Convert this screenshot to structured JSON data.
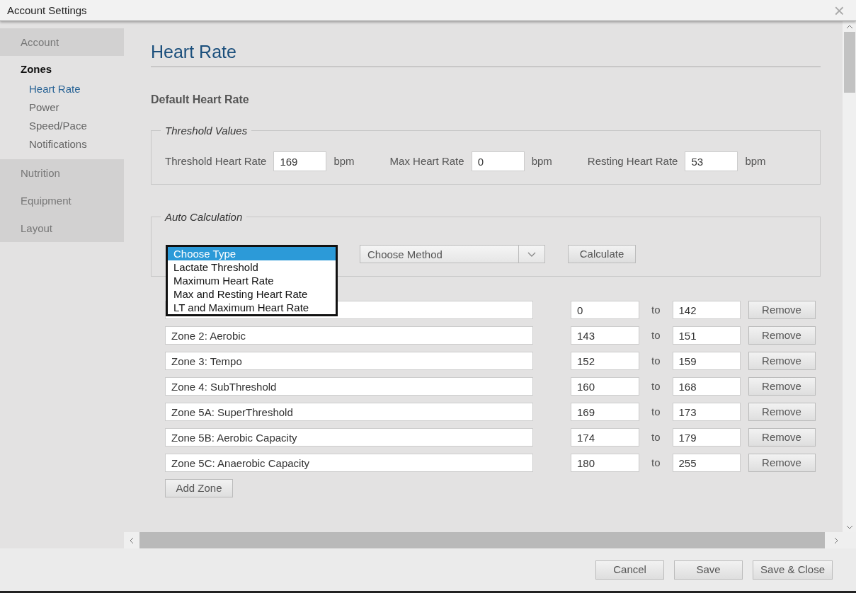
{
  "window": {
    "title": "Account Settings",
    "close": "×"
  },
  "sidebar": {
    "items": [
      {
        "label": "Account",
        "selected": false
      },
      {
        "label": "Zones",
        "selected": true,
        "children": [
          {
            "label": "Heart Rate",
            "selected": true
          },
          {
            "label": "Power",
            "selected": false
          },
          {
            "label": "Speed/Pace",
            "selected": false
          },
          {
            "label": "Notifications",
            "selected": false
          }
        ]
      },
      {
        "label": "Nutrition",
        "selected": false
      },
      {
        "label": "Equipment",
        "selected": false
      },
      {
        "label": "Layout",
        "selected": false
      }
    ]
  },
  "page": {
    "title": "Heart Rate",
    "section": "Default Heart Rate"
  },
  "threshold_values": {
    "legend": "Threshold Values",
    "fields": [
      {
        "label": "Threshold Heart Rate",
        "value": "169",
        "unit": "bpm"
      },
      {
        "label": "Max Heart Rate",
        "value": "0",
        "unit": "bpm"
      },
      {
        "label": "Resting Heart Rate",
        "value": "53",
        "unit": "bpm"
      }
    ]
  },
  "auto_calculation": {
    "legend": "Auto Calculation",
    "type_options": [
      {
        "label": "Choose Type",
        "selected": true
      },
      {
        "label": "Lactate Threshold",
        "selected": false
      },
      {
        "label": "Maximum Heart Rate",
        "selected": false
      },
      {
        "label": "Max and Resting Heart Rate",
        "selected": false
      },
      {
        "label": "LT and Maximum Heart Rate",
        "selected": false
      }
    ],
    "method": "Choose Method",
    "calculate": "Calculate"
  },
  "zones": [
    {
      "from": "0",
      "to_label": "to",
      "to": "142",
      "remove": "Remove"
    },
    {
      "name": "Zone 2: Aerobic",
      "from": "143",
      "to_label": "to",
      "to": "151",
      "remove": "Remove"
    },
    {
      "name": "Zone 3: Tempo",
      "from": "152",
      "to_label": "to",
      "to": "159",
      "remove": "Remove"
    },
    {
      "name": "Zone 4: SubThreshold",
      "from": "160",
      "to_label": "to",
      "to": "168",
      "remove": "Remove"
    },
    {
      "name": "Zone 5A: SuperThreshold",
      "from": "169",
      "to_label": "to",
      "to": "173",
      "remove": "Remove"
    },
    {
      "name": "Zone 5B: Aerobic Capacity",
      "from": "174",
      "to_label": "to",
      "to": "179",
      "remove": "Remove"
    },
    {
      "name": "Zone 5C: Anaerobic Capacity",
      "from": "180",
      "to_label": "to",
      "to": "255",
      "remove": "Remove"
    }
  ],
  "add_zone": "Add Zone",
  "footer": {
    "buttons": [
      "Cancel",
      "Save",
      "Save & Close"
    ]
  }
}
